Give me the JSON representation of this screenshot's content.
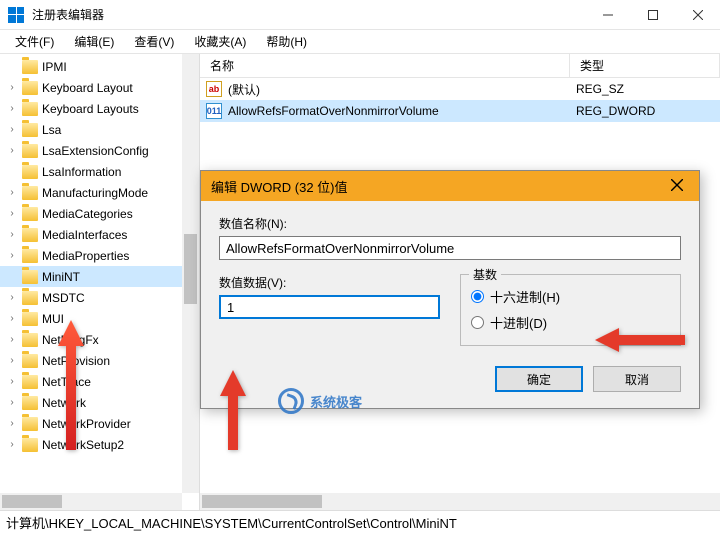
{
  "window": {
    "title": "注册表编辑器"
  },
  "menu": {
    "file": "文件(F)",
    "edit": "编辑(E)",
    "view": "查看(V)",
    "fav": "收藏夹(A)",
    "help": "帮助(H)"
  },
  "tree": {
    "items": [
      {
        "label": "IPMI",
        "exp": ""
      },
      {
        "label": "Keyboard Layout",
        "exp": "›"
      },
      {
        "label": "Keyboard Layouts",
        "exp": "›"
      },
      {
        "label": "Lsa",
        "exp": "›"
      },
      {
        "label": "LsaExtensionConfig",
        "exp": "›"
      },
      {
        "label": "LsaInformation",
        "exp": ""
      },
      {
        "label": "ManufacturingMode",
        "exp": "›"
      },
      {
        "label": "MediaCategories",
        "exp": "›"
      },
      {
        "label": "MediaInterfaces",
        "exp": "›"
      },
      {
        "label": "MediaProperties",
        "exp": "›"
      },
      {
        "label": "MiniNT",
        "exp": "",
        "selected": true
      },
      {
        "label": "MSDTC",
        "exp": "›"
      },
      {
        "label": "MUI",
        "exp": "›"
      },
      {
        "label": "NetDiagFx",
        "exp": "›"
      },
      {
        "label": "NetProvision",
        "exp": "›"
      },
      {
        "label": "NetTrace",
        "exp": "›"
      },
      {
        "label": "Network",
        "exp": "›"
      },
      {
        "label": "NetworkProvider",
        "exp": "›"
      },
      {
        "label": "NetworkSetup2",
        "exp": "›"
      }
    ]
  },
  "list": {
    "headers": {
      "name": "名称",
      "type": "类型"
    },
    "rows": [
      {
        "icon": "str",
        "name": "(默认)",
        "type": "REG_SZ"
      },
      {
        "icon": "dw",
        "name": "AllowRefsFormatOverNonmirrorVolume",
        "type": "REG_DWORD",
        "sel": true
      }
    ]
  },
  "dialog": {
    "title": "编辑 DWORD (32 位)值",
    "name_label": "数值名称(N):",
    "name_value": "AllowRefsFormatOverNonmirrorVolume",
    "data_label": "数值数据(V):",
    "data_value": "1",
    "base_legend": "基数",
    "hex_label": "十六进制(H)",
    "dec_label": "十进制(D)",
    "ok": "确定",
    "cancel": "取消"
  },
  "statusbar": "计算机\\HKEY_LOCAL_MACHINE\\SYSTEM\\CurrentControlSet\\Control\\MiniNT",
  "watermark": "系统极客"
}
